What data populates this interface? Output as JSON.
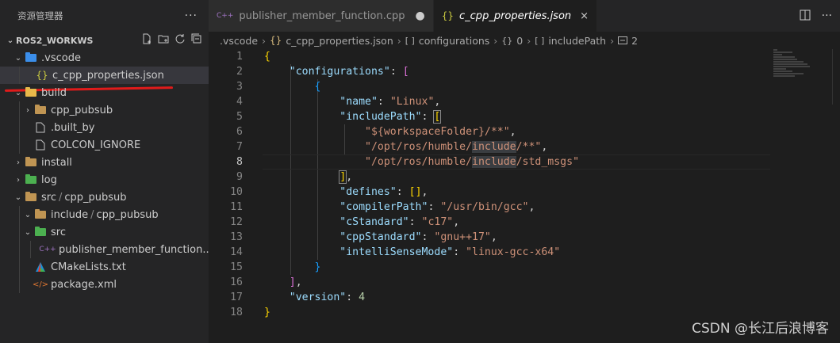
{
  "sidebar": {
    "title": "资源管理器",
    "more": "···",
    "workspace": "ROS2_WORKWS",
    "tree": [
      {
        "label": ".vscode",
        "kind": "folder",
        "open": true
      },
      {
        "label": "c_cpp_properties.json",
        "kind": "json",
        "icon": "{}"
      },
      {
        "label": "build",
        "kind": "folder",
        "open": true
      },
      {
        "label": "cpp_pubsub",
        "kind": "folder",
        "open": false
      },
      {
        "label": ".built_by",
        "kind": "file"
      },
      {
        "label": "COLCON_IGNORE",
        "kind": "file"
      },
      {
        "label": "install",
        "kind": "folder",
        "open": false
      },
      {
        "label": "log",
        "kind": "folder",
        "open": false
      },
      {
        "label": "src",
        "sep": "/",
        "sub": "cpp_pubsub",
        "kind": "folder",
        "open": true
      },
      {
        "label": "include",
        "sep": "/",
        "sub": "cpp_pubsub",
        "kind": "folder",
        "open": true
      },
      {
        "label": "src",
        "kind": "folder",
        "open": true
      },
      {
        "label": "publisher_member_function....",
        "kind": "cpp",
        "icon": "C++"
      },
      {
        "label": "CMakeLists.txt",
        "kind": "cmake"
      },
      {
        "label": "package.xml",
        "kind": "xml",
        "icon": "</>"
      }
    ]
  },
  "tabs": [
    {
      "label": "publisher_member_function.cpp",
      "icon": "C++",
      "modified": "●"
    },
    {
      "label": "c_cpp_properties.json",
      "icon": "{}",
      "close": "×"
    }
  ],
  "breadcrumb": {
    "folder": ".vscode",
    "file": "c_cpp_properties.json",
    "key1": "configurations",
    "index": "0",
    "key2": "includePath",
    "item": "2",
    "obj_icon": "{}",
    "arr_icon": "[ ]"
  },
  "code": {
    "line_numbers": [
      "1",
      "2",
      "3",
      "4",
      "5",
      "6",
      "7",
      "8",
      "9",
      "10",
      "11",
      "12",
      "13",
      "14",
      "15",
      "16",
      "17",
      "18"
    ],
    "current_line": "8",
    "lines": {
      "l1": "{",
      "l2_key": "\"configurations\"",
      "l2_bracket": "[",
      "l3": "{",
      "l4_key": "\"name\"",
      "l4_val": "\"Linux\"",
      "l5_key": "\"includePath\"",
      "l5_bracket": "[",
      "l6_val": "\"${workspaceFolder}/**\"",
      "l7_pre": "\"/opt/ros/humble/",
      "l7_hl": "include",
      "l7_post": "/**\"",
      "l8_pre": "\"/opt/ros/humble/",
      "l8_hl": "include",
      "l8_post": "/std_msgs\"",
      "l9": "]",
      "l10_key": "\"defines\"",
      "l10_val": "[]",
      "l11_key": "\"compilerPath\"",
      "l11_val": "\"/usr/bin/gcc\"",
      "l12_key": "\"cStandard\"",
      "l12_val": "\"c17\"",
      "l13_key": "\"cppStandard\"",
      "l13_val": "\"gnu++17\"",
      "l14_key": "\"intelliSenseMode\"",
      "l14_val": "\"linux-gcc-x64\"",
      "l15": "}",
      "l16": "]",
      "l17_key": "\"version\"",
      "l17_val": "4",
      "l18": "}"
    }
  },
  "watermark": "CSDN @长江后浪博客",
  "colors": {
    "folder_vscode": "#3b8eea",
    "folder_build": "#e8b84a",
    "folder_install": "#c09553",
    "folder_log": "#4cb050",
    "folder_src": "#c09553",
    "folder_src_green": "#4cb050",
    "json_icon": "#cbcb41",
    "cpp_icon": "#a074c4",
    "xml_icon": "#e37933",
    "underline_annotation": "#e01b1b"
  }
}
